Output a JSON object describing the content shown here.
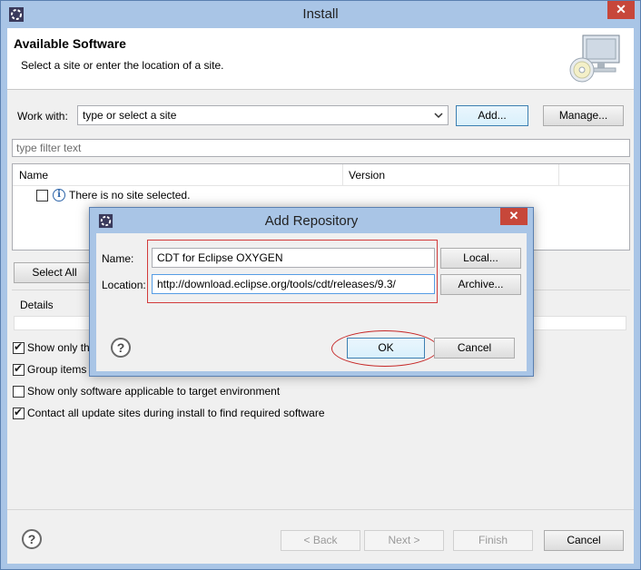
{
  "window": {
    "title": "Install",
    "close_glyph": "✕"
  },
  "header": {
    "title": "Available Software",
    "subtitle": "Select a site or enter the location of a site."
  },
  "work_with": {
    "label": "Work with:",
    "placeholder": "type or select a site",
    "add_button": "Add...",
    "manage_button": "Manage..."
  },
  "filter": {
    "placeholder": "type filter text"
  },
  "tree": {
    "columns": [
      "Name",
      "Version"
    ],
    "row_message": "There is no site selected."
  },
  "select_all_button": "Select All",
  "details_label": "Details",
  "options": [
    {
      "label": "Show only the latest versions of available software",
      "checked": true
    },
    {
      "label": "Group items by category",
      "checked": true
    },
    {
      "label": "Show only software applicable to target environment",
      "checked": false
    },
    {
      "label": "Contact all update sites during install to find required software",
      "checked": true
    }
  ],
  "footer": {
    "back_button": "< Back",
    "next_button": "Next >",
    "finish_button": "Finish",
    "cancel_button": "Cancel"
  },
  "dialog": {
    "title": "Add Repository",
    "close_glyph": "✕",
    "name_label": "Name:",
    "name_value": "CDT for Eclipse OXYGEN",
    "location_label": "Location:",
    "location_value": "http://download.eclipse.org/tools/cdt/releases/9.3/",
    "local_button": "Local...",
    "archive_button": "Archive...",
    "ok_button": "OK",
    "cancel_button": "Cancel"
  },
  "colors": {
    "annotation": "#c62828",
    "titlebar": "#a9c5e6",
    "close": "#c7473a"
  }
}
